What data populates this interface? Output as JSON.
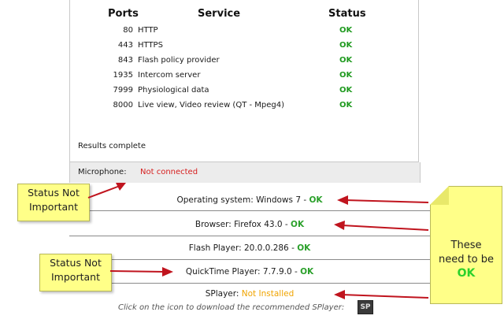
{
  "ports_table": {
    "headers": {
      "ports": "Ports",
      "service": "Service",
      "status": "Status"
    },
    "rows": [
      {
        "port": "80",
        "service": "HTTP",
        "status": "OK"
      },
      {
        "port": "443",
        "service": "HTTPS",
        "status": "OK"
      },
      {
        "port": "843",
        "service": "Flash policy provider",
        "status": "OK"
      },
      {
        "port": "1935",
        "service": "Intercom server",
        "status": "OK"
      },
      {
        "port": "7999",
        "service": "Physiological data",
        "status": "OK"
      },
      {
        "port": "8000",
        "service": "Live view, Video review (QT - Mpeg4)",
        "status": "OK"
      }
    ],
    "results_text": "Results complete"
  },
  "microphone": {
    "label": "Microphone:",
    "value": "Not connected"
  },
  "system_checks": [
    {
      "label": "Operating system: Windows 7 - ",
      "status": "OK"
    },
    {
      "label": "Browser: Firefox 43.0 - ",
      "status": "OK"
    },
    {
      "label": "Flash Player: 20.0.0.286 - ",
      "status": "OK"
    },
    {
      "label": "QuickTime Player: 7.7.9.0 - ",
      "status": "OK"
    },
    {
      "label": "SPlayer: ",
      "status": "Not Installed"
    }
  ],
  "download": {
    "text": "Click on the icon to download the recommended SPlayer:",
    "icon_text": "SP"
  },
  "notes": {
    "note1": {
      "line1": "Status Not",
      "line2": "Important"
    },
    "note2": {
      "line1": "Status Not",
      "line2": "Important"
    },
    "note3": {
      "line1": "These",
      "line2": "need to be",
      "ok": "OK"
    }
  },
  "colors": {
    "ok_green": "#2aa02a",
    "not_connected_red": "#d61f1f",
    "not_installed_orange": "#f0a400",
    "note_yellow": "#ffff88",
    "arrow_red": "#c0141e"
  }
}
